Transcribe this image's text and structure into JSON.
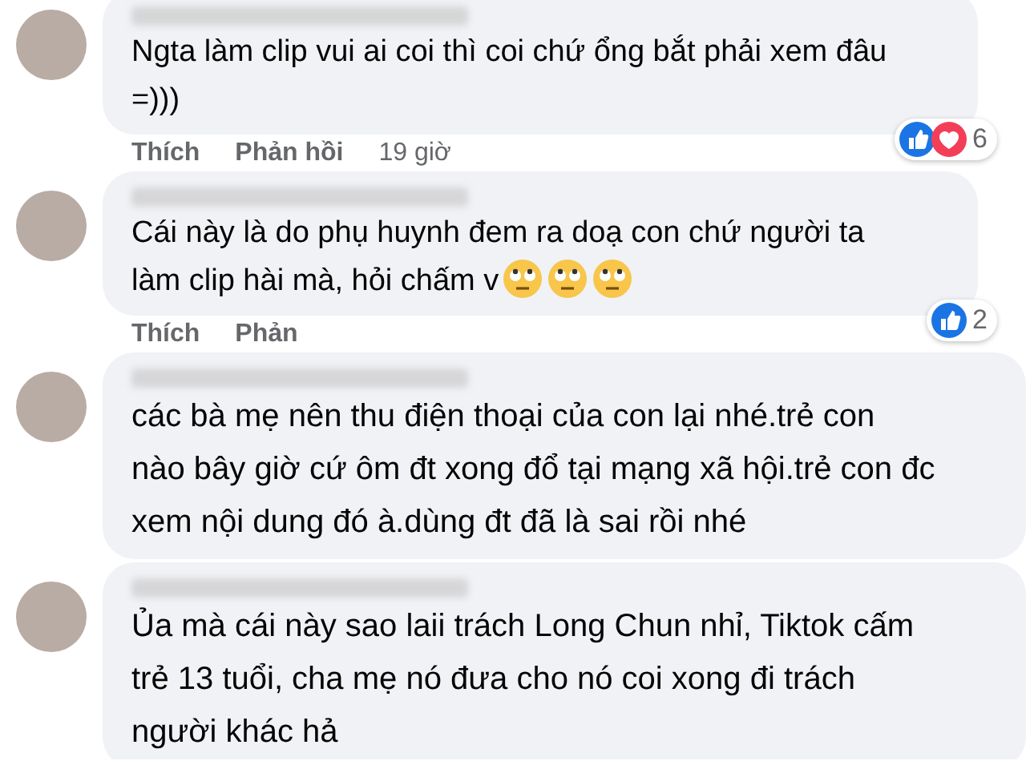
{
  "comments": [
    {
      "kind": "plain",
      "text": "Ngta làm clip vui ai coi thì coi chứ ổng bắt phải xem đâu =)))",
      "actions": [
        "Thích",
        "Phản hồi"
      ],
      "time": "19 giờ",
      "reactions": {
        "icons": [
          {
            "kind": "like"
          },
          {
            "kind": "love"
          }
        ],
        "count": "6"
      }
    },
    {
      "kind": "emoji",
      "text": "Cái này là do phụ huynh đem ra doạ con chứ người ta làm clip hài mà, hỏi chấm v",
      "actions": [
        "Thích",
        "Phản"
      ],
      "reactions": {
        "icons": [
          {
            "kind": "like"
          }
        ],
        "count": "2"
      }
    },
    {
      "kind": "wide",
      "text": "các bà mẹ nên thu điện thoại của con lại nhé.trẻ con nào bây giờ cứ ôm đt xong đổ tại mạng xã hội.trẻ con đc xem nội dung đó à.dùng đt đã là sai rồi nhé"
    },
    {
      "kind": "wide",
      "text": "Ủa mà cái này sao laii trách Long Chun nhỉ, Tiktok cấm trẻ 13 tuổi, cha mẹ nó đưa cho nó coi xong đi trách người khác hả"
    }
  ]
}
